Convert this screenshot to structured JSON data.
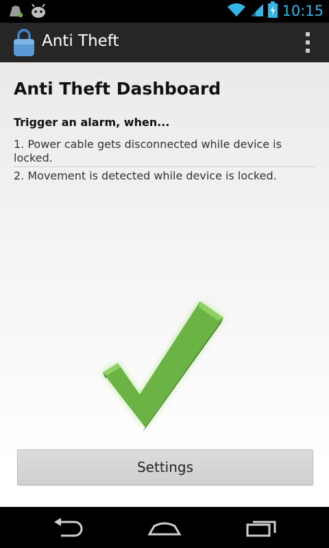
{
  "status_bar": {
    "time": "10:15",
    "left_icons": [
      "usb-debugging-icon",
      "android-notification-icon"
    ],
    "right_icons": [
      "wifi-icon",
      "signal-icon",
      "battery-charging-icon"
    ],
    "accent_color": "#33b5e5"
  },
  "action_bar": {
    "title": "Anti Theft",
    "app_icon": "padlock-icon",
    "overflow_icon": "overflow-menu-icon"
  },
  "dashboard": {
    "title": "Anti Theft Dashboard",
    "trigger_label": "Trigger an alarm, when...",
    "rules": [
      "1. Power cable gets disconnected while device is locked.",
      "2. Movement is detected while device is locked."
    ],
    "status_icon": "green-checkmark-icon",
    "status_color": "#6ab344"
  },
  "settings_button": {
    "label": "Settings"
  },
  "nav_bar": {
    "buttons": [
      "back-icon",
      "home-icon",
      "recent-apps-icon"
    ]
  }
}
